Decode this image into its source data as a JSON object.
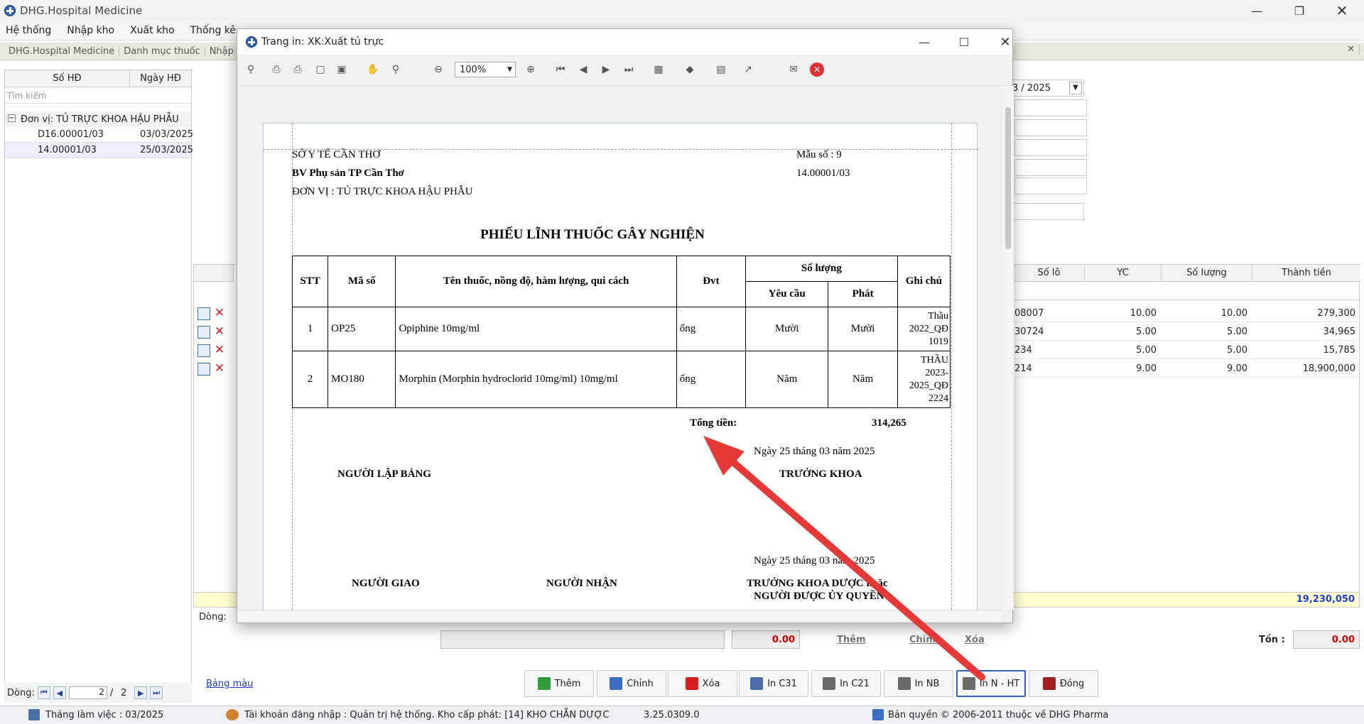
{
  "app": {
    "title": "DHG.Hospital Medicine",
    "menu": [
      "Hệ thống",
      "Nhập kho",
      "Xuất kho",
      "Thống kê"
    ],
    "tabs": [
      "DHG.Hospital Medicine",
      "Danh mục thuốc",
      "Nhập ch"
    ]
  },
  "left_panel": {
    "columns": [
      "Số HĐ",
      "Ngày HĐ"
    ],
    "search_placeholder": "Tìm kiếm",
    "group": "Đơn vị:  TỦ TRỰC KHOA HẬU PHẪU",
    "rows": [
      {
        "so": "D16.00001/03",
        "ngay": "03/03/2025"
      },
      {
        "so": "14.00001/03",
        "ngay": "25/03/2025"
      }
    ],
    "dong_label": "Dòng:",
    "page_current": "2",
    "page_total": "2"
  },
  "right_form": {
    "month_value": "3 / 2025"
  },
  "grid": {
    "columns": [
      "Số lô",
      "YC",
      "Số lượng",
      "Thành tiền"
    ],
    "rows": [
      {
        "lo": "08007",
        "yc": "10.00",
        "sl": "10.00",
        "tt": "279,300"
      },
      {
        "lo": "30724",
        "yc": "5.00",
        "sl": "5.00",
        "tt": "34,965"
      },
      {
        "lo": "234",
        "yc": "5.00",
        "sl": "5.00",
        "tt": "15,785"
      },
      {
        "lo": "214",
        "yc": "9.00",
        "sl": "9.00",
        "tt": "18,900,000"
      }
    ],
    "total": "19,230,050",
    "dong_label": "Dòng:"
  },
  "bottom": {
    "amount": "0.00",
    "them": "Thêm",
    "chinh": "Chỉnh",
    "xoa": "Xóa",
    "ton_label": "Tồn :",
    "ton_value": "0.00",
    "bang_mau": "Bảng màu"
  },
  "buttons": [
    {
      "label": "Thêm",
      "color": "#2e9e3a"
    },
    {
      "label": "Chỉnh",
      "color": "#3a6fc2"
    },
    {
      "label": "Xóa",
      "color": "#d62020"
    },
    {
      "label": "In C31",
      "color": "#4a6fa8"
    },
    {
      "label": "In C21",
      "color": "#6a6a6a"
    },
    {
      "label": "In NB",
      "color": "#6a6a6a"
    },
    {
      "label": "In N - HT",
      "color": "#6a6a6a"
    },
    {
      "label": "Đóng",
      "color": "#a02020"
    }
  ],
  "status": {
    "thang": "Tháng làm việc : 03/2025",
    "account": "Tài khoản đăng nhập : Quản trị hệ thống. Kho cấp phát: [14] KHO CHẴN DƯỢC",
    "version": "3.25.0309.0",
    "copyright": "Bản quyền © 2006-2011 thuộc về DHG Pharma"
  },
  "dialog": {
    "title": "Trang in: XK:Xuất tủ trực",
    "zoom": "100%"
  },
  "report": {
    "so_y_te": "SỞ Y TẾ CẦN THƠ",
    "bv": "BV Phụ sản TP Cần Thơ",
    "don_vi": "ĐƠN VỊ : TỦ TRỰC KHOA HẬU PHẪU",
    "mau_so": "Mẫu số : 9",
    "so_phieu": "14.00001/03",
    "title": "PHIẾU LĨNH THUỐC GÂY NGHIỆN",
    "headers": {
      "stt": "STT",
      "ma": "Mã số",
      "ten": "Tên thuốc, nồng độ, hàm lượng, qui cách",
      "dvt": "Đvt",
      "so_luong": "Số lượng",
      "yeu_cau": "Yêu cầu",
      "phat": "Phát",
      "ghi_chu": "Ghi chú"
    },
    "rows": [
      {
        "stt": "1",
        "ma": "OP25",
        "ten": "Opiphine 10mg/ml",
        "dvt": "ống",
        "yc": "Mười",
        "phat": "Mười",
        "ghichu": "Thầu 2022_QĐ 1019"
      },
      {
        "stt": "2",
        "ma": "MO180",
        "ten": "Morphin (Morphin hydroclorid 10mg/ml) 10mg/ml",
        "dvt": "ống",
        "yc": "Năm",
        "phat": "Năm",
        "ghichu": "THẦU 2023-2025_QĐ 2224"
      }
    ],
    "tong_tien_label": "Tổng tiền:",
    "tong_tien": "314,265",
    "date1": "Ngày 25 tháng 03 năm 2025",
    "nguoi_lap": "NGƯỜI LẬP BẢNG",
    "truong_khoa": "TRƯỞNG KHOA",
    "date2": "Ngày 25 tháng 03 năm 2025",
    "nguoi_giao": "NGƯỜI GIAO",
    "nguoi_nhan": "NGƯỜI NHẬN",
    "tk_duoc_1": "TRƯỞNG KHOA DƯỢC hoặc",
    "tk_duoc_2": "NGƯỜI ĐƯỢC ỦY QUYỀN"
  },
  "colors": {
    "accent": "#2a62b9",
    "arrow": "#e53935",
    "total_blue": "#1a3cc8",
    "red_value": "#d00000"
  }
}
